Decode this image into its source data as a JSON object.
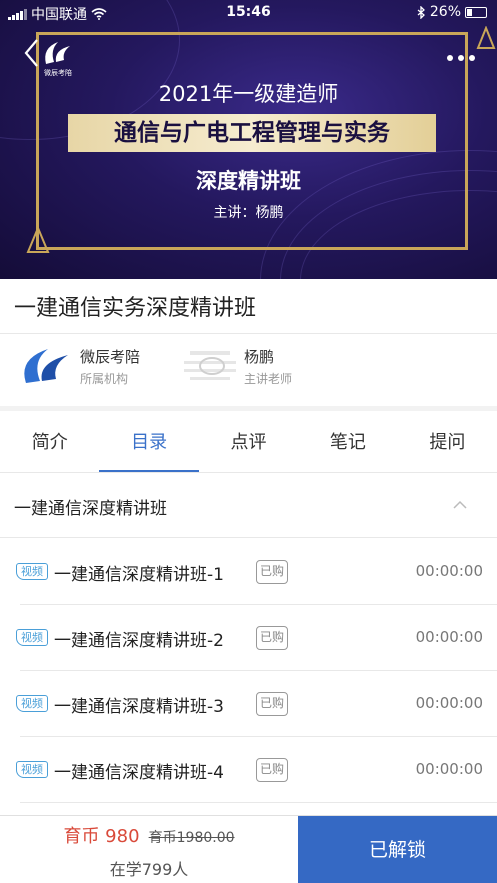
{
  "status_bar": {
    "carrier": "中国联通",
    "time": "15:46",
    "battery": "26%"
  },
  "banner": {
    "logo_caption": "微辰考陪",
    "line1": "2021年一级建造师",
    "line2": "通信与广电工程管理与实务",
    "line3": "深度精讲班",
    "line4": "主讲：杨鹏"
  },
  "course": {
    "title": "一建通信实务深度精讲班"
  },
  "org": {
    "name": "微辰考陪",
    "sub": "所属机构"
  },
  "teacher": {
    "name": "杨鹏",
    "sub": "主讲老师"
  },
  "tabs": [
    {
      "label": "简介"
    },
    {
      "label": "目录"
    },
    {
      "label": "点评"
    },
    {
      "label": "笔记"
    },
    {
      "label": "提问"
    }
  ],
  "active_tab": "目录",
  "section": {
    "title": "一建通信深度精讲班"
  },
  "lessons": [
    {
      "badge": "视频",
      "title": "一建通信深度精讲班-1",
      "status": "已购",
      "duration": "00:00:00"
    },
    {
      "badge": "视频",
      "title": "一建通信深度精讲班-2",
      "status": "已购",
      "duration": "00:00:00"
    },
    {
      "badge": "视频",
      "title": "一建通信深度精讲班-3",
      "status": "已购",
      "duration": "00:00:00"
    },
    {
      "badge": "视频",
      "title": "一建通信深度精讲班-4",
      "status": "已购",
      "duration": "00:00:00"
    }
  ],
  "purchase": {
    "price": "育币 980",
    "original_price": "育币1980.00",
    "learners": "在学799人",
    "button": "已解锁"
  },
  "colors": {
    "accent": "#3a71c9",
    "price": "#d94a3a",
    "button": "#3569c4",
    "badge": "#4a9fd8",
    "frame_gold": "#c9a659"
  }
}
